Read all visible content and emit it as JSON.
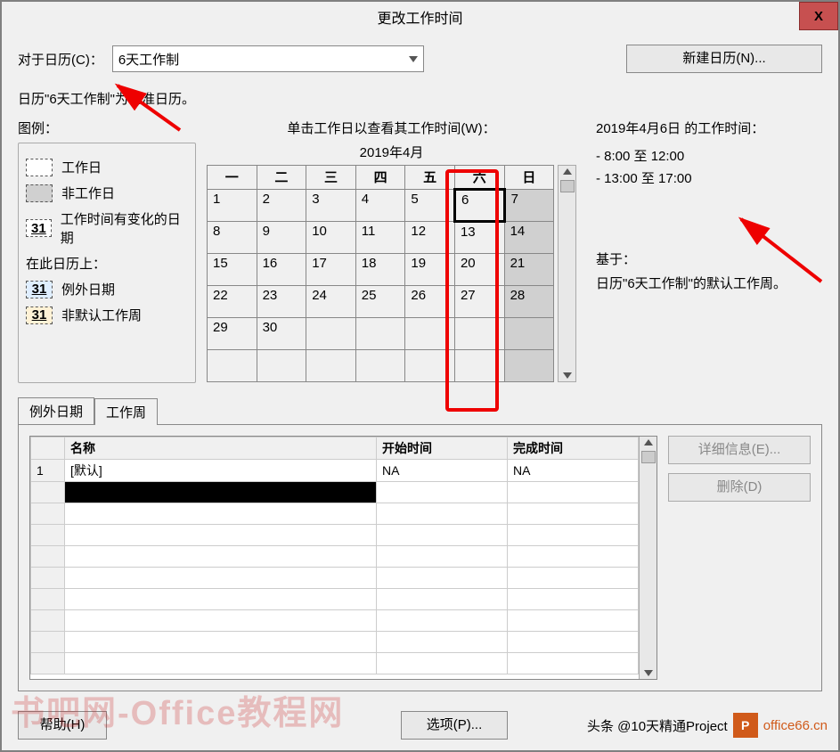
{
  "title": "更改工作时间",
  "close_label": "X",
  "row1": {
    "label": "对于日历(C)：",
    "selected": "6天工作制",
    "new_btn": "新建日历(N)..."
  },
  "base_text": "日历\"6天工作制\"为基准日历。",
  "legend": {
    "title": "图例：",
    "working": "工作日",
    "nonworking": "非工作日",
    "changed": "工作时间有变化的日期",
    "changed_num": "31",
    "on_this": "在此日历上：",
    "exception": "例外日期",
    "exception_num": "31",
    "nondefault": "非默认工作周",
    "nondefault_num": "31"
  },
  "calendar": {
    "caption": "单击工作日以查看其工作时间(W)：",
    "month": "2019年4月",
    "days": [
      "一",
      "二",
      "三",
      "四",
      "五",
      "六",
      "日"
    ],
    "weeks": [
      [
        "1",
        "2",
        "3",
        "4",
        "5",
        "6",
        "7"
      ],
      [
        "8",
        "9",
        "10",
        "11",
        "12",
        "13",
        "14"
      ],
      [
        "15",
        "16",
        "17",
        "18",
        "19",
        "20",
        "21"
      ],
      [
        "22",
        "23",
        "24",
        "25",
        "26",
        "27",
        "28"
      ],
      [
        "29",
        "30",
        "",
        "",
        "",
        "",
        ""
      ],
      [
        "",
        "",
        "",
        "",
        "",
        "",
        ""
      ]
    ]
  },
  "info": {
    "title": "2019年4月6日 的工作时间：",
    "line1": "- 8:00 至 12:00",
    "line2": "- 13:00 至 17:00",
    "based_label": "基于：",
    "based_text": "日历\"6天工作制\"的默认工作周。"
  },
  "tabs": {
    "t1": "例外日期",
    "t2": "工作周"
  },
  "grid": {
    "headers": [
      "",
      "名称",
      "开始时间",
      "完成时间"
    ],
    "row1": {
      "num": "1",
      "name": "[默认]",
      "start": "NA",
      "end": "NA"
    }
  },
  "side_btns": {
    "details": "详细信息(E)...",
    "delete": "删除(D)"
  },
  "footer": {
    "help": "帮助(H)",
    "options": "选项(P)..."
  },
  "watermark1": "书吧网-Office教程网",
  "watermark2": {
    "t1": "头条 @10天精通Project",
    "t2": "office66.cn"
  }
}
